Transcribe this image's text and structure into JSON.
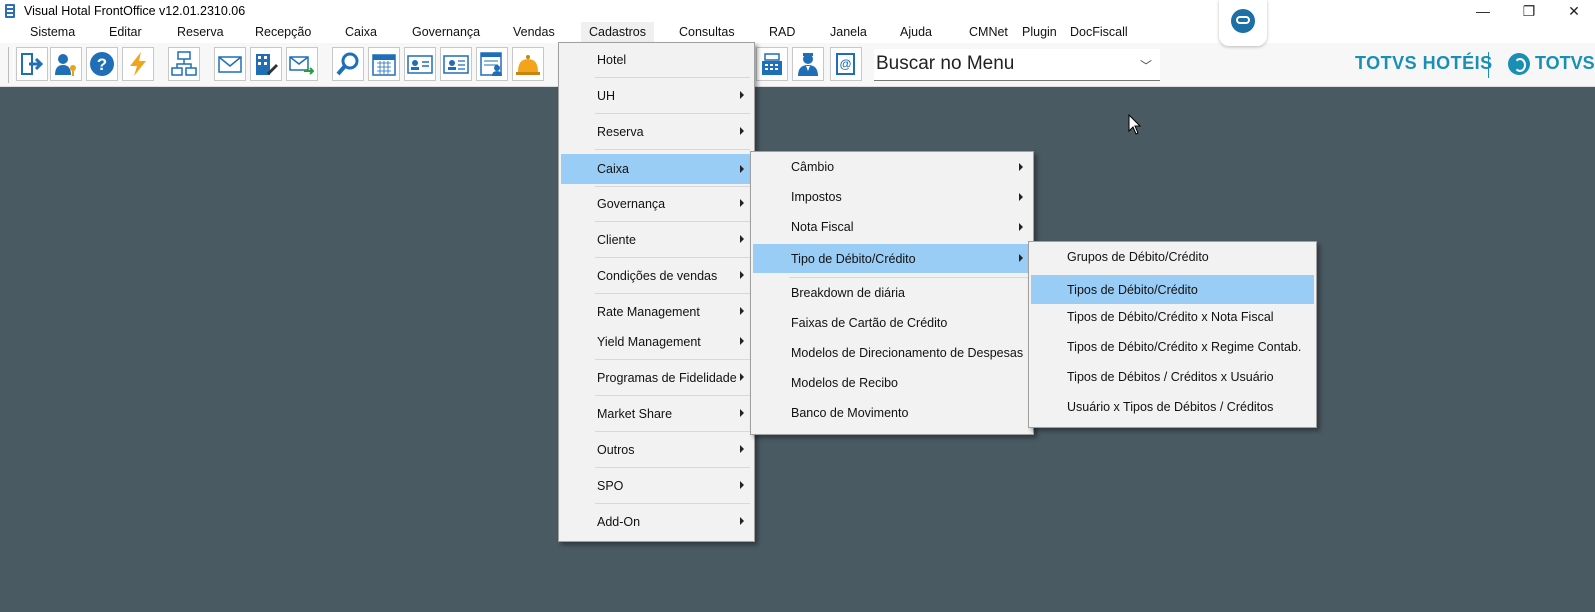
{
  "window": {
    "title": "Visual Hotal FrontOffice v12.01.2310.06",
    "minimize": "—",
    "maximize": "❐",
    "close": "✕"
  },
  "menubar": [
    "Sistema",
    "Editar",
    "Reserva",
    "Recepção",
    "Caixa",
    "Governança",
    "Vendas",
    "Cadastros",
    "Consultas",
    "RAD",
    "Janela",
    "Ajuda",
    "CMNet",
    "Plugin",
    "DocFiscall"
  ],
  "search": {
    "value": "Buscar no Menu"
  },
  "brand": {
    "name": "TOTVS HOTÉIS",
    "logo_text": "TOTVS",
    "accent": "#1a8fb5"
  },
  "menu_cadastros": [
    {
      "label": "Hotel",
      "submenu": false
    },
    {
      "label": "UH",
      "submenu": true
    },
    {
      "label": "Reserva",
      "submenu": true
    },
    {
      "label": "Caixa",
      "submenu": true,
      "highlighted": true
    },
    {
      "label": "Governança",
      "submenu": true
    },
    {
      "label": "Cliente",
      "submenu": true
    },
    {
      "label": "Condições de vendas",
      "submenu": true
    },
    {
      "label": "Rate Management",
      "submenu": true
    },
    {
      "label": "Yield Management",
      "submenu": true
    },
    {
      "label": "Programas de Fidelidade",
      "submenu": true
    },
    {
      "label": "Market Share",
      "submenu": true
    },
    {
      "label": "Outros",
      "submenu": true
    },
    {
      "label": "SPO",
      "submenu": true
    },
    {
      "label": "Add-On",
      "submenu": true
    }
  ],
  "menu_caixa": [
    {
      "label": "Câmbio",
      "submenu": true
    },
    {
      "label": "Impostos",
      "submenu": true
    },
    {
      "label": "Nota Fiscal",
      "submenu": true
    },
    {
      "label": "Tipo de Débito/Crédito",
      "submenu": true,
      "highlighted": true
    },
    {
      "label": "Breakdown de diária",
      "submenu": false
    },
    {
      "label": "Faixas de Cartão de Crédito",
      "submenu": false
    },
    {
      "label": "Modelos de Direcionamento de Despesas",
      "submenu": false
    },
    {
      "label": "Modelos de Recibo",
      "submenu": false
    },
    {
      "label": "Banco de Movimento",
      "submenu": false
    }
  ],
  "menu_tipo": [
    {
      "label": "Grupos de Débito/Crédito"
    },
    {
      "label": "Tipos de Débito/Crédito",
      "highlighted": true
    },
    {
      "label": "Tipos de Débito/Crédito x Nota Fiscal"
    },
    {
      "label": "Tipos de Débito/Crédito x Regime Contab."
    },
    {
      "label": "Tipos de Débitos / Créditos x Usuário"
    },
    {
      "label": "Usuário x Tipos de Débitos / Créditos"
    }
  ],
  "toolbar_icons": [
    "exit-icon",
    "user-key-icon",
    "help-icon",
    "lightning-icon",
    "org-chart-icon",
    "envelope-icon",
    "building-edit-icon",
    "send-mail-icon",
    "search-icon",
    "calendar-icon",
    "guest-card-icon",
    "guest-card-alt-icon",
    "calendar-person-icon",
    "bell-icon",
    "cash-register-icon",
    "concierge-icon",
    "email-book-icon"
  ],
  "colors": {
    "menu_highlight": "#99cdf6",
    "background": "#4a5a62"
  }
}
